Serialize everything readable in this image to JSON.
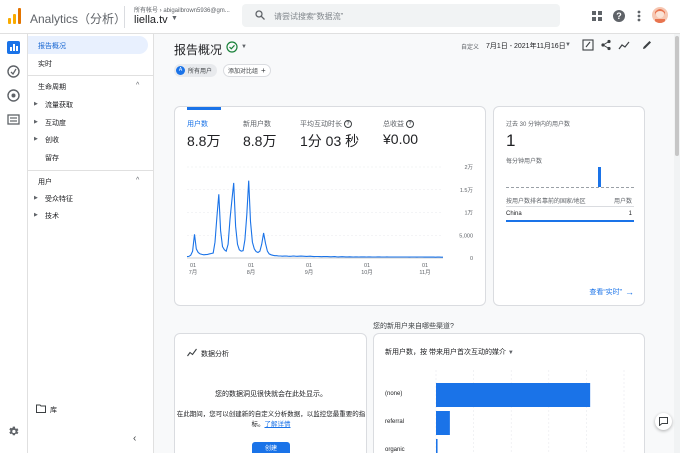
{
  "header": {
    "app_title": "Analytics（分析）",
    "account_line": "所有帐号 › abigailbrown5936@gm...",
    "property_name": "liella.tv",
    "search_placeholder": "请尝试搜索“数据流”"
  },
  "sidebar": {
    "overview": "报告概况",
    "realtime": "实时",
    "lifecycle": {
      "title": "生命周期",
      "items": [
        "流量获取",
        "互动度",
        "创收",
        "留存"
      ]
    },
    "user": {
      "title": "用户",
      "items": [
        "受众特征",
        "技术"
      ]
    },
    "library": "库"
  },
  "main": {
    "page_title": "报告概况",
    "date_label": "自定义",
    "date_range": "7月1日 - 2021年11月16日",
    "chips": {
      "all_users": "所有用户",
      "add_comparison": "添加对比组"
    },
    "metrics": [
      {
        "label": "用户数",
        "value": "8.8万"
      },
      {
        "label": "新用户数",
        "value": "8.8万"
      },
      {
        "label": "平均互动时长",
        "value": "1分 03 秒"
      },
      {
        "label": "总收益",
        "value": "¥0.00"
      }
    ],
    "realtime_card": {
      "title": "过去 30 分钟内的用户数",
      "count": "1",
      "per_minute": "每分钟用户数",
      "col_country": "按用户数排名靠前的国家/地区",
      "col_users": "用户数",
      "rows": [
        {
          "country": "China",
          "users": "1"
        }
      ],
      "link": "查看“实时”"
    },
    "question": "您的新用户来自哪些渠道?",
    "insights_card": {
      "title": "数据分析",
      "message": "您的数据洞见很快就会在此处显示。",
      "hint_prefix": "在此期间，您可以创建新的自定义分析数据，以监控您最重要的指标。",
      "hint_link": "了解详情",
      "create": "创建"
    },
    "source_card": {
      "heading": "新用户数，按 带来用户首次互动的媒介",
      "bars": [
        {
          "label": "(none)",
          "value": 1.0
        },
        {
          "label": "referral",
          "value": 0.09
        },
        {
          "label": "organic",
          "value": 0.01
        }
      ]
    }
  },
  "chart_data": {
    "type": "line",
    "x_tick_labels": [
      {
        "day": "01",
        "month": "7月"
      },
      {
        "day": "01",
        "month": "8月"
      },
      {
        "day": "01",
        "month": "9月"
      },
      {
        "day": "01",
        "month": "10月"
      },
      {
        "day": "01",
        "month": "11月"
      }
    ],
    "y_ticks": [
      "0",
      "5,000",
      "1万",
      "1.5万",
      "2万"
    ],
    "y_tick_values": [
      0,
      5000,
      10000,
      15000,
      20000
    ],
    "ylim": [
      0,
      20000
    ],
    "series": [
      {
        "values": [
          300,
          350,
          600,
          1500,
          5200,
          2000,
          1200,
          900,
          800,
          700,
          750,
          800,
          900,
          1000,
          1100,
          3500,
          9000,
          14000,
          6000,
          2500,
          1800,
          1500,
          3000,
          8500,
          12500,
          16500,
          7000,
          3000,
          1800,
          1500,
          1600,
          4000,
          9500,
          17000,
          8000,
          3500,
          2000,
          1400,
          1200,
          1500,
          3000,
          5500,
          3200,
          1500,
          900,
          700,
          600,
          500,
          500,
          450,
          450,
          400,
          420,
          450,
          400,
          380,
          400,
          450,
          400,
          380,
          400,
          420,
          400,
          380,
          350,
          380,
          400,
          350,
          300,
          320,
          340,
          300,
          280,
          300,
          320,
          300,
          280,
          260,
          280,
          300,
          270,
          250,
          260,
          280,
          260,
          240,
          250,
          260,
          240,
          230,
          250,
          240,
          230,
          240,
          250,
          240,
          230,
          250,
          240,
          230,
          220,
          230,
          250,
          240,
          230,
          220,
          230,
          240,
          230,
          220,
          210,
          220,
          230,
          220,
          210,
          220,
          230,
          220,
          210,
          200,
          210,
          220,
          210,
          200,
          210,
          220,
          210,
          200,
          190,
          200,
          210,
          200,
          190,
          180,
          200,
          190,
          180,
          170
        ]
      }
    ],
    "colors": {
      "line": "#1a73e8"
    }
  },
  "colors": {
    "accent": "#1a73e8"
  }
}
